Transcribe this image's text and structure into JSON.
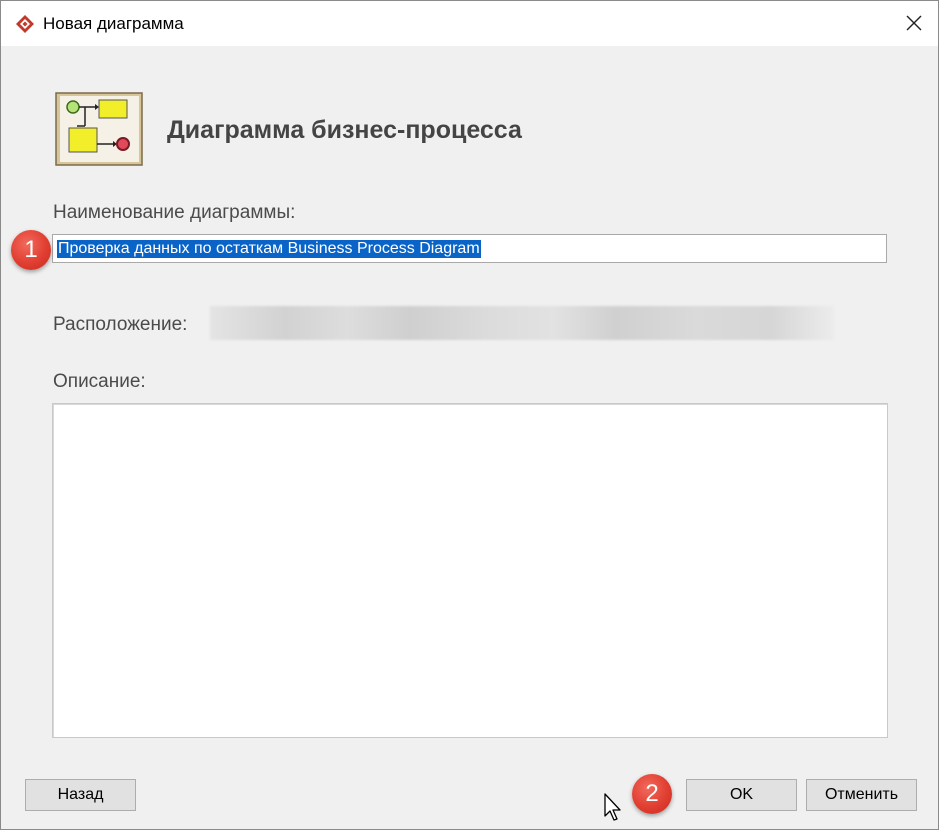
{
  "window": {
    "title": "Новая диаграмма",
    "close_icon": "close-icon",
    "app_icon": "app-logo-icon"
  },
  "header": {
    "icon": "business-process-diagram-icon",
    "title": "Диаграмма бизнес-процесса"
  },
  "form": {
    "name_label": "Наименование диаграммы:",
    "name_value": "Проверка данных по остаткам Business Process Diagram",
    "location_label": "Расположение:",
    "description_label": "Описание:",
    "description_value": ""
  },
  "buttons": {
    "back": "Назад",
    "ok": "OK",
    "cancel": "Отменить"
  },
  "annotations": {
    "marker_1": "1",
    "marker_2": "2"
  },
  "colors": {
    "selection": "#0a64c8",
    "marker": "#e03e30",
    "dialog_bg": "#f0f0f0"
  }
}
